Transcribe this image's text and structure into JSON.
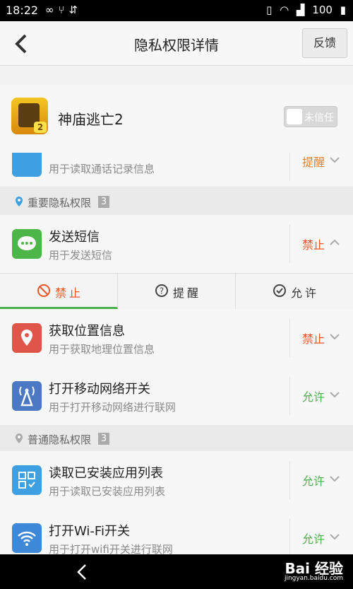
{
  "status_bar": {
    "time": "18:22",
    "battery": "100"
  },
  "header": {
    "title": "隐私权限详情",
    "feedback_label": "反馈"
  },
  "app": {
    "name": "神庙逃亡2",
    "icon_badge": "2",
    "trust_label": "未信任"
  },
  "rows": {
    "call_log": {
      "desc": "用于读取通话记录信息",
      "status": "提醒",
      "status_color": "#e8812a"
    },
    "sms": {
      "title": "发送短信",
      "desc": "用于发送短信",
      "status": "禁止",
      "status_color": "#e8582a"
    },
    "location": {
      "title": "获取位置信息",
      "desc": "用于获取地理位置信息",
      "status": "禁止",
      "status_color": "#e8582a"
    },
    "mobile_net": {
      "title": "打开移动网络开关",
      "desc": "用于打开移动网络进行联网",
      "status": "允许",
      "status_color": "#4caf50"
    },
    "app_list": {
      "title": "读取已安装应用列表",
      "desc": "用于读取已安装应用列表",
      "status": "允许",
      "status_color": "#4caf50"
    },
    "wifi": {
      "title": "打开Wi-Fi开关",
      "desc": "用于打开wifi开关进行联网",
      "status": "允许",
      "status_color": "#4caf50"
    }
  },
  "sections": {
    "important": {
      "title": "重要隐私权限",
      "count": "3"
    },
    "normal": {
      "title": "普通隐私权限",
      "count": "3"
    }
  },
  "choices": {
    "deny": "禁止",
    "ask": "提醒",
    "allow": "允许",
    "selected": "deny"
  },
  "watermark": {
    "text": "Bai 经验",
    "sub": "jingyan.baidu.com"
  }
}
